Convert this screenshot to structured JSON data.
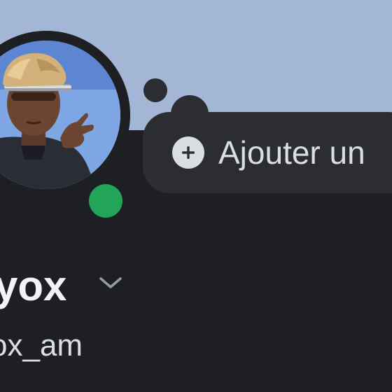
{
  "profile": {
    "display_name": "yox",
    "username": "ox_am",
    "online_status": "online",
    "avatar_icon": "user-avatar-photo"
  },
  "custom_status": {
    "label": "Ajouter un",
    "icon": "plus-circle-icon"
  },
  "name_menu": {
    "icon": "chevron-down-icon"
  },
  "colors": {
    "banner": "#a3b6d6",
    "background": "#1e1f22",
    "bubble": "#2b2d31",
    "status_online": "#23a559",
    "text_primary": "#f2f3f5",
    "text_secondary": "#dbdee1"
  }
}
